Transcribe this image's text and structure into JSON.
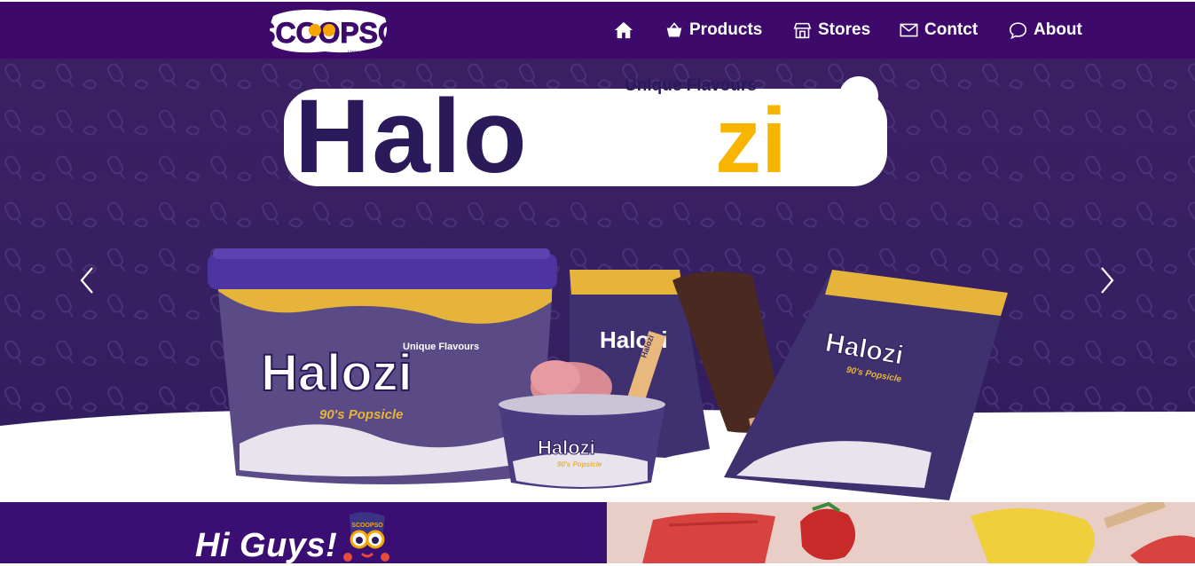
{
  "brand": {
    "logo_text": "SCOOPSO",
    "logo_tagline": "Unique Flavours"
  },
  "nav": {
    "home_label": "",
    "products_label": "Products",
    "stores_label": "Stores",
    "contact_label": "Contct",
    "about_label": "About"
  },
  "hero": {
    "banner_tagline": "Unique Flavours",
    "banner_title_dark": "Halo",
    "banner_title_accent": "zi",
    "tub_tagline": "Unique Flavours",
    "tub_title": "Halozi",
    "tub_subtitle": "90's Popsicle",
    "cup_title": "Halozi",
    "cup_subtitle": "90's Popsicle",
    "bar1_title": "Halozi",
    "bar2_title": "Halozi",
    "bar2_subtitle": "90's Popsicle",
    "stick_text": "Halozi"
  },
  "intro": {
    "greeting": "Hi Guys!",
    "mascot_badge": "SCOOPSO"
  },
  "colors": {
    "navbar_bg": "#3d0a6b",
    "hero_bg": "#352062",
    "accent_yellow": "#f7b500",
    "dark_purple_text": "#2b1a5a"
  },
  "icons": {
    "home": "home-icon",
    "products": "basket-icon",
    "stores": "store-icon",
    "contact": "envelope-icon",
    "about": "chat-bubble-icon",
    "prev": "chevron-left-icon",
    "next": "chevron-right-icon"
  }
}
